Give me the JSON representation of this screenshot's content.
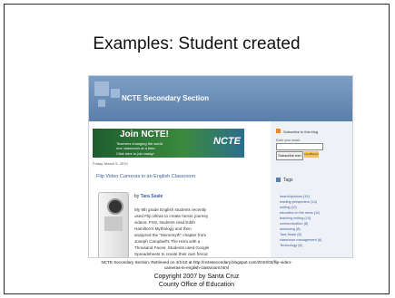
{
  "slide": {
    "title": "Examples: Student created",
    "caption_line1": "NCTE Secondary Section. Retrieved on 4/1/10 at http://nctesecondary.blogspot.com/2010/03/flip-video-",
    "caption_line2": "cameras-in-english-classroom.html",
    "copyright_line1": "Copyright 2007 by Santa Cruz",
    "copyright_line2": "County Office of Education"
  },
  "blog": {
    "title": "NCTE Secondary Section",
    "banner": {
      "title": "Join NCTE!",
      "line1": "Teachers changing the world",
      "line2": "one classroom at a time.",
      "click": "Click here to join today!",
      "logo": "NCTE"
    },
    "post": {
      "date": "Friday, March 5, 2010",
      "title": "Flip Video Cameras in an English Classroom",
      "byline_prefix": "by",
      "author": "Tara Seale",
      "body_lines": [
        "My 9th grade English students recently",
        "used Flip Ultras to create heroic journey",
        "videos. First, students read Edith",
        "Hamilton's Mythology and then",
        "analyzed the \"Monomyth\" chapter from",
        "Joseph Campbell's The Hero with a",
        "Thousand Faces. Students used Google",
        "Spreadsheets to create their own heroic"
      ]
    },
    "sidebar": {
      "subscribe_label": "Subscribe to this blog",
      "email_label": "Enter your email:",
      "subscribe_button": "Subscribe me!",
      "feedburner": "FeedBurner",
      "tags_title": "Tags",
      "tags": [
        "heard/opinions (19)",
        "reading perspective (14)",
        "writing (10)",
        "education in the news (11)",
        "teaching writing (10)",
        "communication (8)",
        "assessing (8)",
        "Tara Seale (8)",
        "classroom management (6)",
        "Technology (6)"
      ]
    }
  }
}
